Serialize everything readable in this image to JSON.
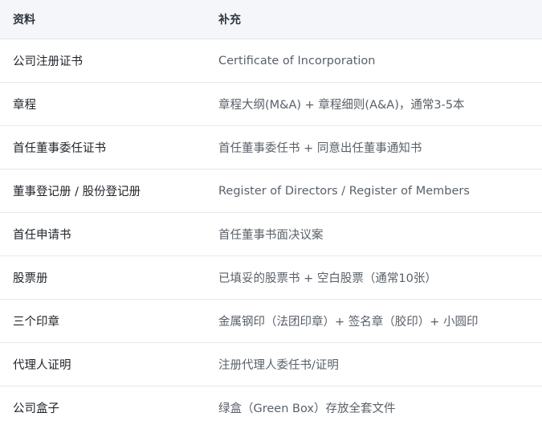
{
  "table": {
    "headers": [
      "资料",
      "补充"
    ],
    "rows": [
      [
        "公司注册证书",
        "Certificate of Incorporation"
      ],
      [
        "章程",
        "章程大纲(M&A) + 章程细则(A&A)，通常3-5本"
      ],
      [
        "首任董事委任证书",
        "首任董事委任书 + 同意出任董事通知书"
      ],
      [
        "董事登记册 / 股份登记册",
        "Register of Directors / Register of Members"
      ],
      [
        "首任申请书",
        "首任董事书面决议案"
      ],
      [
        "股票册",
        "已填妥的股票书 + 空白股票（通常10张）"
      ],
      [
        "三个印章",
        "金属钢印（法团印章）+ 签名章（胶印）+ 小圆印"
      ],
      [
        "代理人证明",
        "注册代理人委任书/证明"
      ],
      [
        "公司盒子",
        "绿盒（Green Box）存放全套文件"
      ]
    ]
  }
}
